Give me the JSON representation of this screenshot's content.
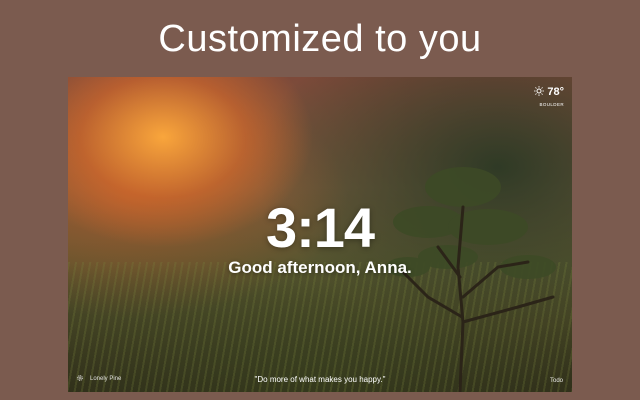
{
  "headline": "Customized to you",
  "weather": {
    "icon": "sun-icon",
    "temperature": "78°",
    "location": "BOULDER"
  },
  "clock": "3:14",
  "greeting": "Good afternoon, Anna.",
  "background_credit": {
    "icon": "gear-icon",
    "label": "Lonely Pine"
  },
  "quote": "\"Do more of what makes you happy.\"",
  "todo_label": "Todo",
  "colors": {
    "page_background": "#7b5b4f",
    "text": "#ffffff"
  }
}
